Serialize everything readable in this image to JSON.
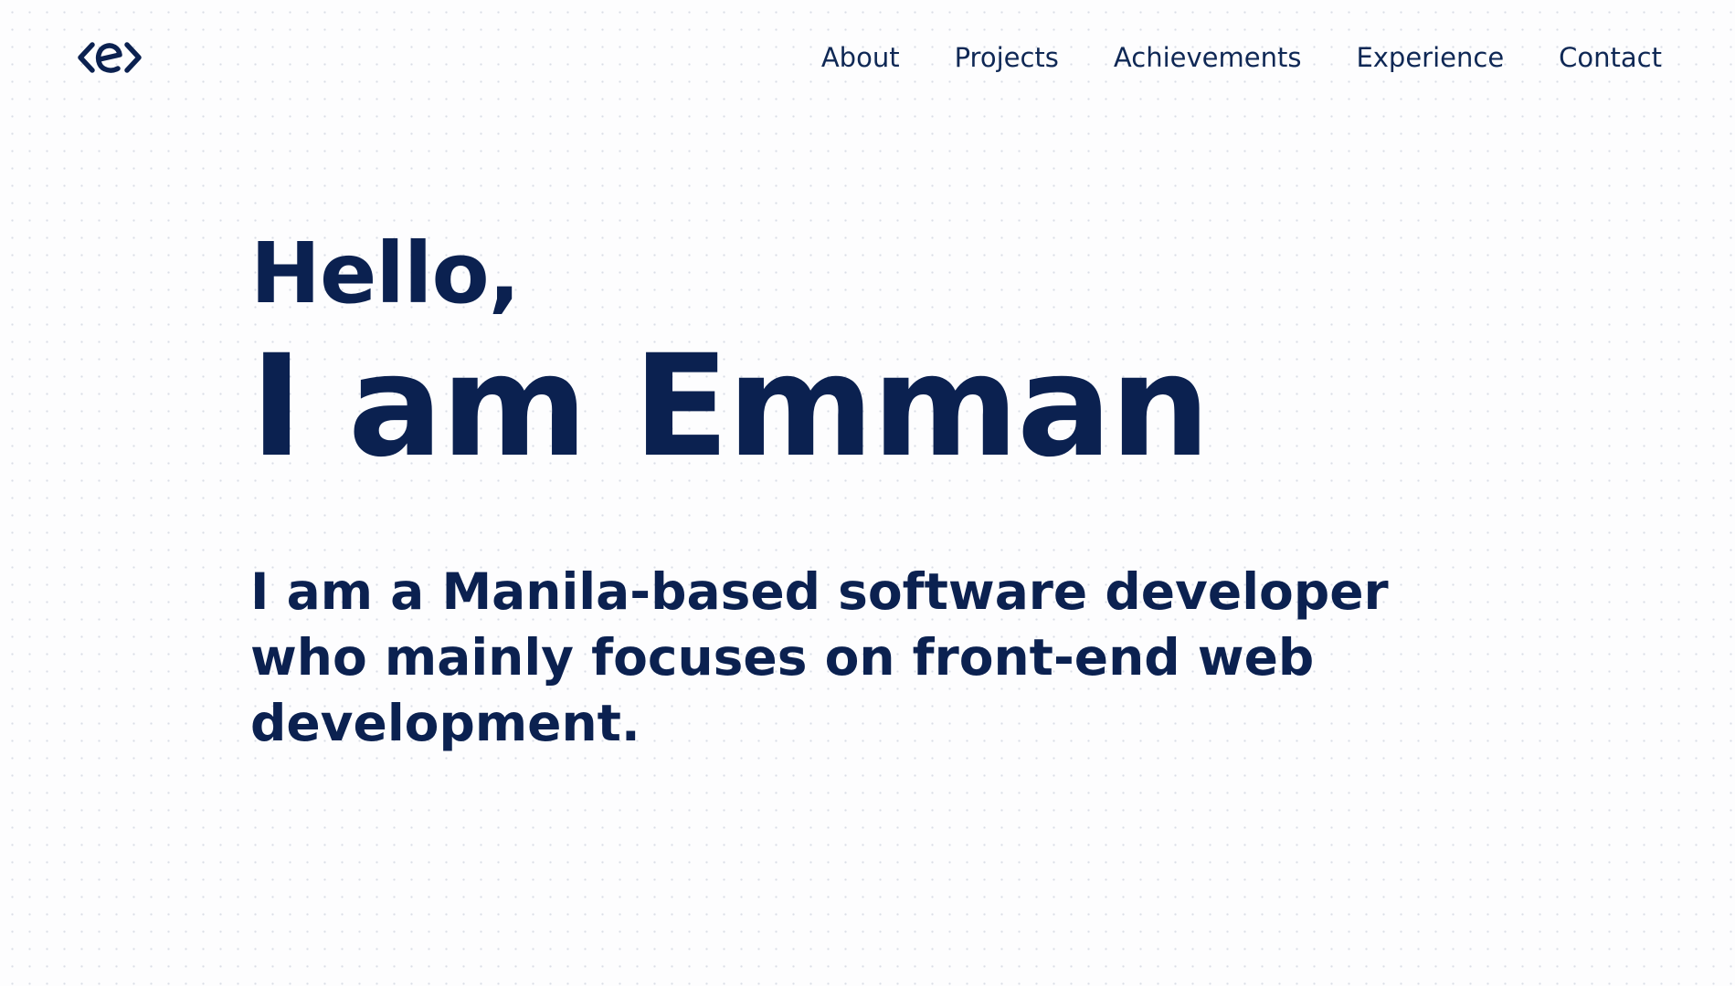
{
  "brand": {
    "logo_icon": "e-code-brackets-logo-icon",
    "accent_color": "#0b2150"
  },
  "nav": {
    "items": [
      {
        "label": "About"
      },
      {
        "label": "Projects"
      },
      {
        "label": "Achievements"
      },
      {
        "label": "Experience"
      },
      {
        "label": "Contact"
      }
    ]
  },
  "hero": {
    "greeting": "Hello,",
    "name": "I am Emman",
    "intro": "I am a Manila-based software developer who mainly focuses on front-end web development."
  }
}
